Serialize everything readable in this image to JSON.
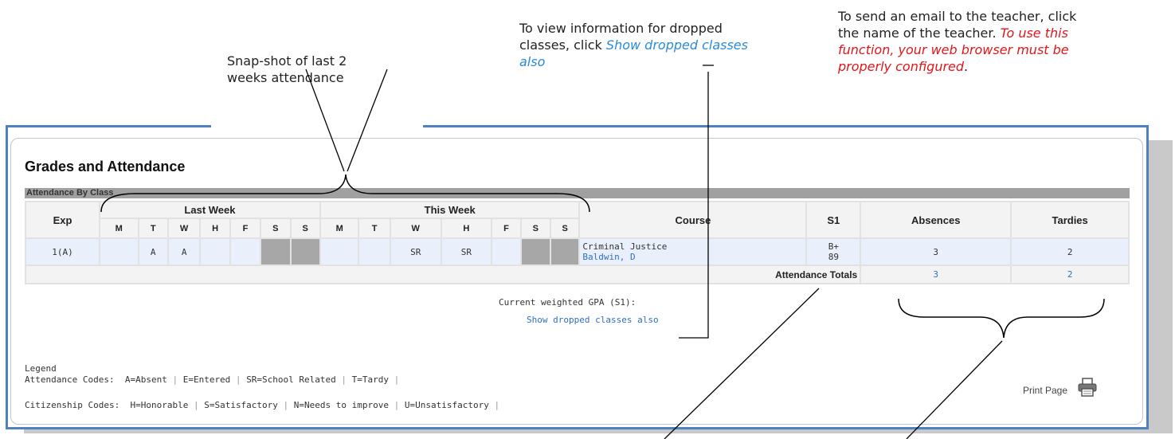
{
  "annotations": {
    "snapshot": [
      "Snap-shot of last 2",
      "weeks attendance"
    ],
    "dropped_prefix": "To view information for dropped classes, click ",
    "dropped_link": "Show dropped classes also",
    "email_plain": "To send an email to the teacher, click the name of the teacher. ",
    "email_red": "To use this function, your web browser must be properly configured",
    "email_end": "."
  },
  "page": {
    "title": "Grades and Attendance",
    "section": "Attendance By Class"
  },
  "table": {
    "headers": {
      "exp": "Exp",
      "last_week": "Last Week",
      "this_week": "This Week",
      "course": "Course",
      "s1": "S1",
      "absences": "Absences",
      "tardies": "Tardies"
    },
    "days": [
      "M",
      "T",
      "W",
      "H",
      "F",
      "S",
      "S",
      "M",
      "T",
      "W",
      "H",
      "F",
      "S",
      "S"
    ],
    "row": {
      "exp": "1(A)",
      "days": [
        "",
        "A",
        "A",
        "",
        "",
        "",
        "",
        "",
        "",
        "SR",
        "SR",
        "",
        "",
        ""
      ],
      "course": "Criminal Justice",
      "teacher": "Baldwin, D",
      "grade": "B+",
      "score": "89",
      "absences": "3",
      "tardies": "2"
    },
    "totals": {
      "label": "Attendance Totals",
      "absences": "3",
      "tardies": "2"
    }
  },
  "gpa_label": "Current weighted GPA (S1):",
  "show_dropped": "Show dropped classes also",
  "legend": {
    "title": "Legend",
    "attendance_label": "Attendance Codes:",
    "attendance_codes": [
      "A=Absent",
      "E=Entered",
      "SR=School Related",
      "T=Tardy"
    ],
    "citizenship_label": "Citizenship Codes:",
    "citizenship_codes": [
      "H=Honorable",
      "S=Satisfactory",
      "N=Needs to improve",
      "U=Unsatisfactory"
    ]
  },
  "print_label": "Print Page",
  "icons": {
    "print": "printer-icon"
  },
  "colors": {
    "frame": "#4f80c2",
    "link": "#2d6fc6",
    "highlight_red": "#e0161b",
    "highlight_blue": "#2a8ad8"
  }
}
